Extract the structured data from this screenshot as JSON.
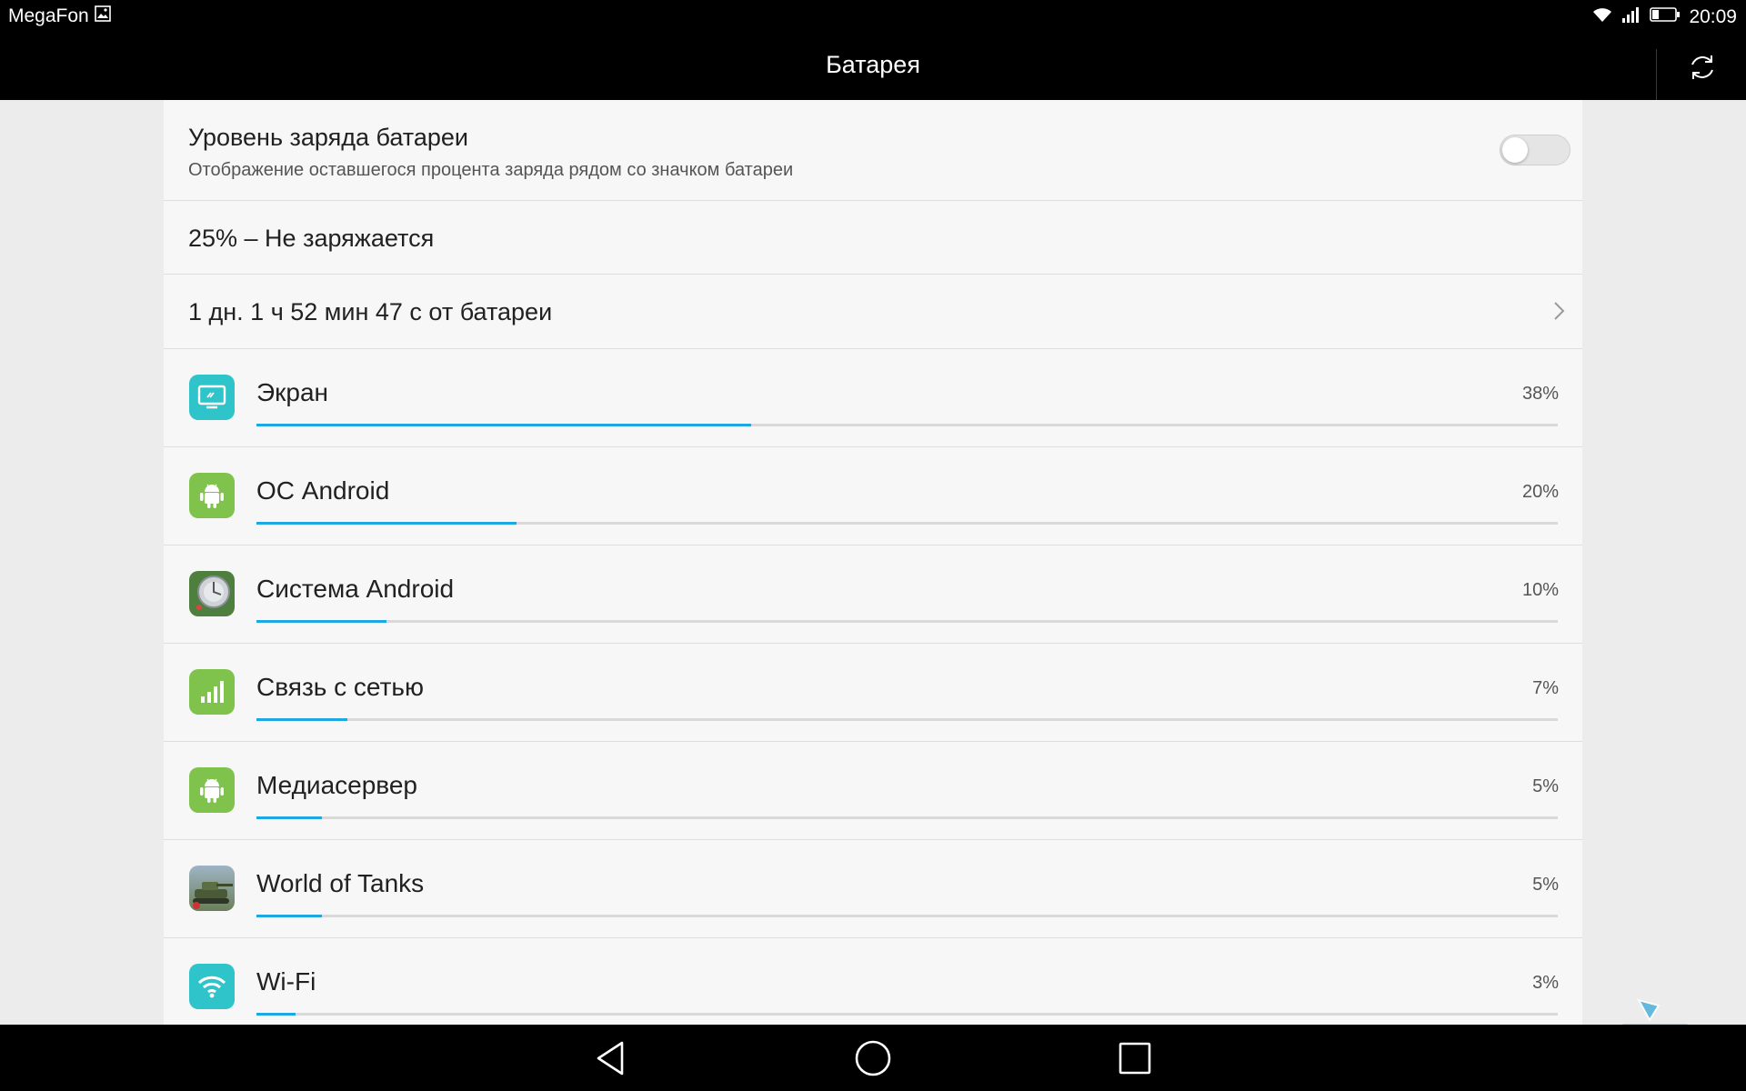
{
  "status_bar": {
    "carrier": "MegaFon",
    "time": "20:09"
  },
  "action_bar": {
    "title": "Батарея"
  },
  "battery_level_setting": {
    "title": "Уровень заряда батареи",
    "subtitle": "Отображение оставшегося процента заряда рядом со значком батареи",
    "enabled": false
  },
  "charge_status": "25% – Не заряжается",
  "on_battery_time": "1 дн. 1 ч 52 мин 47 с от батареи",
  "usage": [
    {
      "name": "Экран",
      "percent_label": "38%",
      "fraction": 0.38,
      "icon": "display-icon",
      "icon_color": "#2ec4c9"
    },
    {
      "name": "ОС Android",
      "percent_label": "20%",
      "fraction": 0.2,
      "icon": "android-icon",
      "icon_color": "#7fc24c"
    },
    {
      "name": "Система Android",
      "percent_label": "10%",
      "fraction": 0.1,
      "icon": "android-system-icon",
      "icon_color": "#5a8a4a"
    },
    {
      "name": "Связь с сетью",
      "percent_label": "7%",
      "fraction": 0.07,
      "icon": "signal-bars-icon",
      "icon_color": "#7fc24c"
    },
    {
      "name": "Медиасервер",
      "percent_label": "5%",
      "fraction": 0.05,
      "icon": "android-icon",
      "icon_color": "#7fc24c"
    },
    {
      "name": "World of Tanks",
      "percent_label": "5%",
      "fraction": 0.05,
      "icon": "tank-game-icon",
      "icon_color": "#6b7f5a"
    },
    {
      "name": "Wi-Fi",
      "percent_label": "3%",
      "fraction": 0.03,
      "icon": "wifi-icon",
      "icon_color": "#2ec4c9"
    }
  ],
  "colors": {
    "accent_bar": "#1ea7e0",
    "panel_bg": "#f7f7f7",
    "page_bg": "#ececec"
  }
}
